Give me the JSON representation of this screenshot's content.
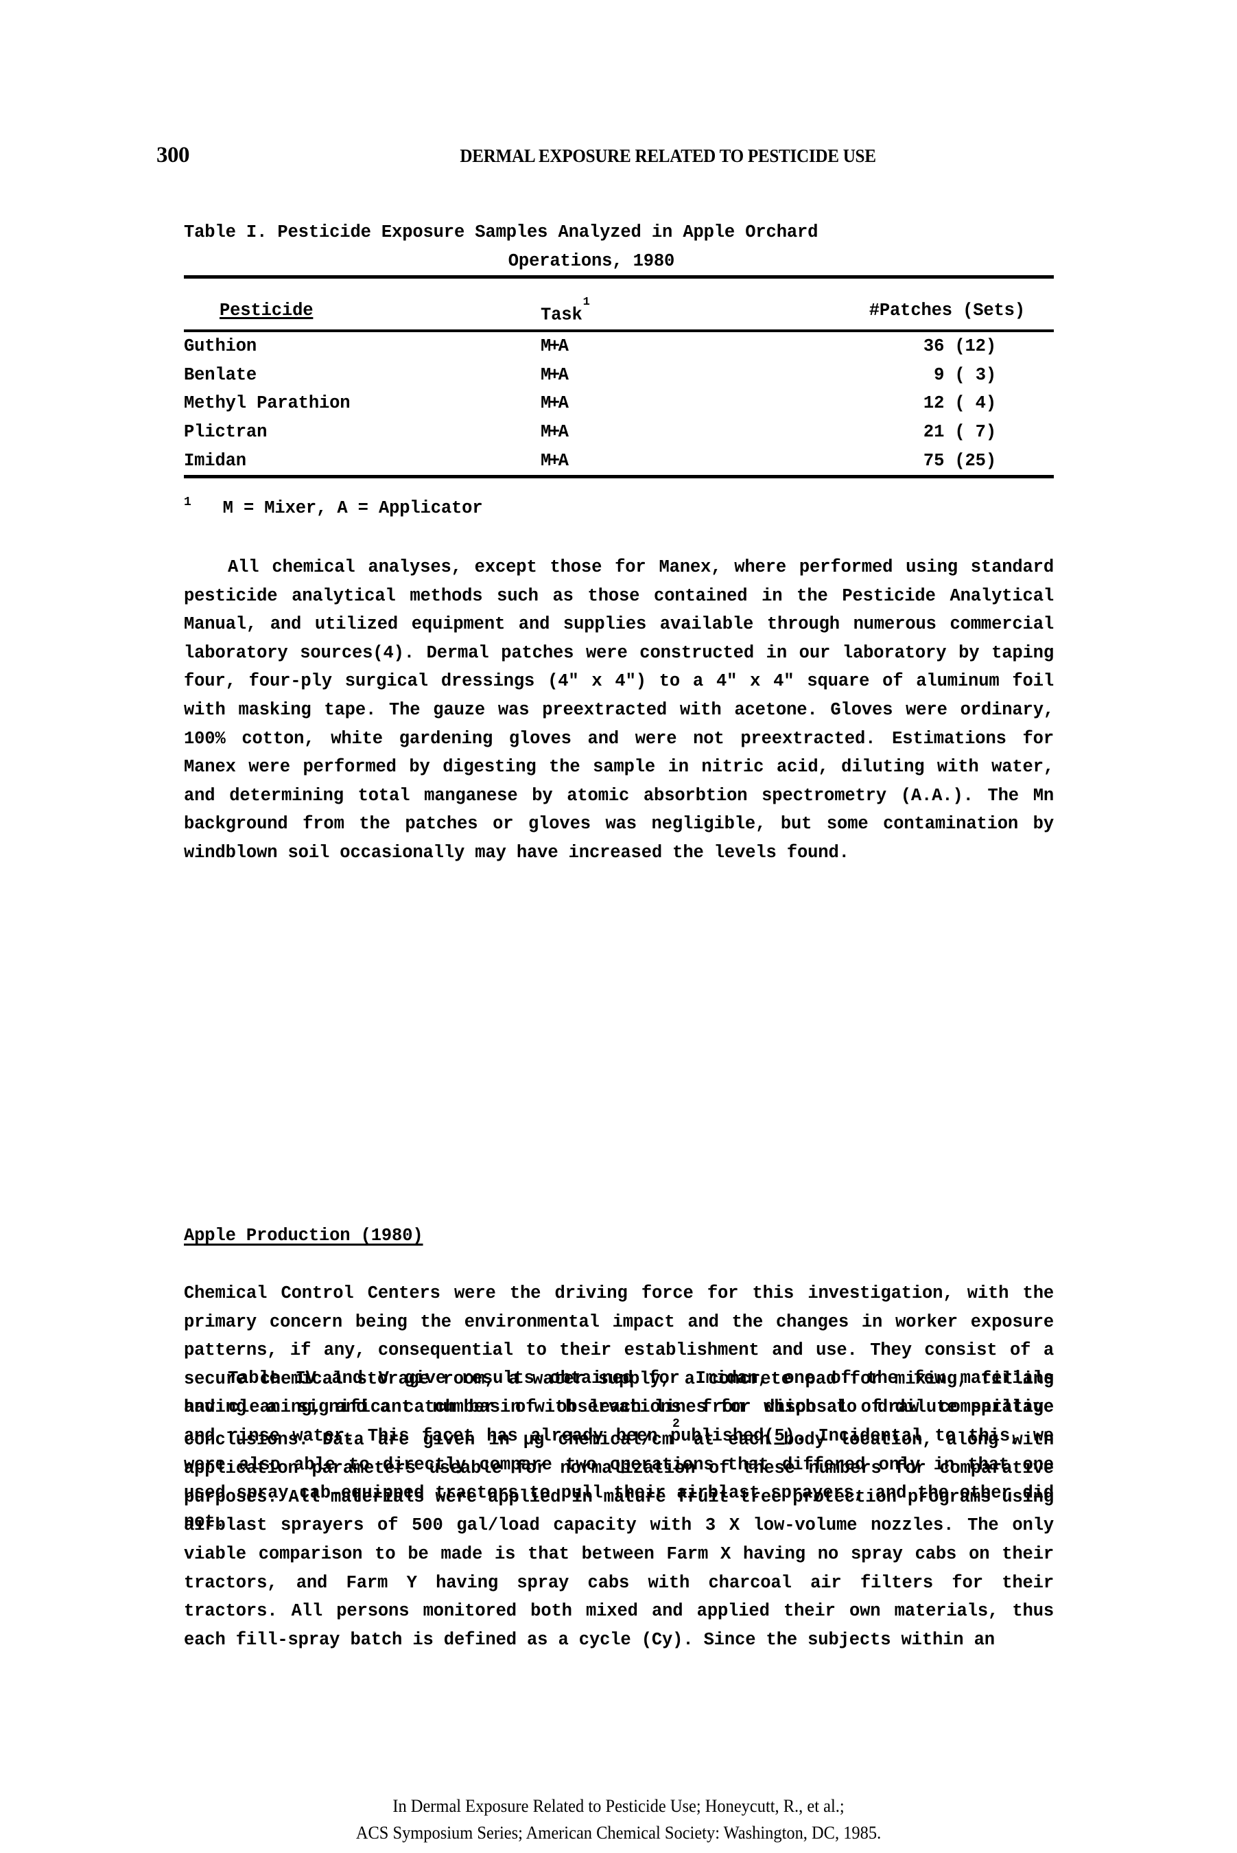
{
  "page": {
    "folio": "300",
    "running_title": "DERMAL EXPOSURE RELATED TO PESTICIDE USE"
  },
  "table": {
    "caption_line1": "Table I.  Pesticide Exposure Samples Analyzed in Apple Orchard",
    "caption_line2": "Operations, 1980",
    "headers": {
      "pesticide": "Pesticide",
      "task": "Task",
      "task_footnote_marker": "1",
      "patches": "#Patches (Sets)"
    },
    "rows": [
      {
        "pesticide": "Guthion",
        "task": "M+A",
        "patches": "36 (12)"
      },
      {
        "pesticide": "Benlate",
        "task": "M+A",
        "patches": "9 ( 3)"
      },
      {
        "pesticide": "Methyl Parathion",
        "task": "M+A",
        "patches": "12 ( 4)"
      },
      {
        "pesticide": "Plictran",
        "task": "M+A",
        "patches": "21 ( 7)"
      },
      {
        "pesticide": "Imidan",
        "task": "M+A",
        "patches": "75 (25)"
      }
    ],
    "footnote_marker": "1",
    "footnote_text": "M = Mixer, A = Applicator"
  },
  "body": {
    "paragraph_methods": "All  chemical  analyses,  except  those  for  Manex,  where performed  using  standard   pesticide analytical methods such as those contained in the Pesticide Analytical Manual, and utilized equipment  and  supplies  available  through numerous commercial laboratory  sources(4).   Dermal patches were constructed in our laboratory by taping four, four-ply surgical dressings (4\" x 4\") to  a  4\"  x  4\" square of aluminum foil with masking tape.  The gauze was preextracted with acetone.  Gloves were ordinary, 100% cotton,  white  gardening  gloves  and  were  not  preextracted. Estimations  for Manex were performed by digesting the sample in nitric   acid,   diluting  with  water,  and  determining  total manganese  by  atomic  absorbtion  spectrometry  (A.A.).  The Mn background  from  the patches or gloves was negligible, but some contamination  by windblown soil occasionally may have increased the levels found.",
    "section_heading": "Apple Production (1980)",
    "paragraph_ccc_part1": "Chemical  Control  Centers  were  the  driving  force  for  this investigation,  with the primary concern being the environmental impact  and  the  changes  in  worker exposure patterns, if any, consequential to their establishment and use.  They consist of a secure chemical storage room, a water supply, a concrete pad for mixing, filling and cleaning, and a catch basin with leach lines for disposal of dilute spillage and rinse water.  This facet has already  been  published(",
    "paragraph_ccc_ref": "5",
    "paragraph_ccc_part2": ").   Incidental  to this, we were also able  to  directly  compare two operations that differed only in that one used spray cab-equipped tractors to pull their airblast sprayers, and the other did not.",
    "paragraph_tables_part1": "Table IV and V give results obtained for Imidan, one of the few  materials  having a significant number of observations from which  to  draw  comparative  conclusions. Data are given in µg chemical/cm",
    "paragraph_tables_sup": "2",
    "paragraph_tables_part2": " at  each  body  location,  along  with application parameters  useable  for  normalization  of  these  numbers  for comparative  purposes.   All  materials  were  applied in mature fruit  tree  protection  programs using airblast sprayers of 500 gal/load  capacity with 3 X low-volume nozzles.  The only viable comparison  to  be  made  is that between Farm X having no spray cabs  on  their  tractors,  and  Farm  Y  having spray cabs with charcoal  air filters for their tractors.  All persons monitored both mixed and applied their own materials, thus each fill-spray batch  is defined as a cycle (Cy).  Since the subjects within an"
  },
  "footer": {
    "line1": "In Dermal Exposure Related to Pesticide Use; Honeycutt, R., et al.;",
    "line2": "ACS Symposium Series; American Chemical Society: Washington, DC, 1985."
  }
}
